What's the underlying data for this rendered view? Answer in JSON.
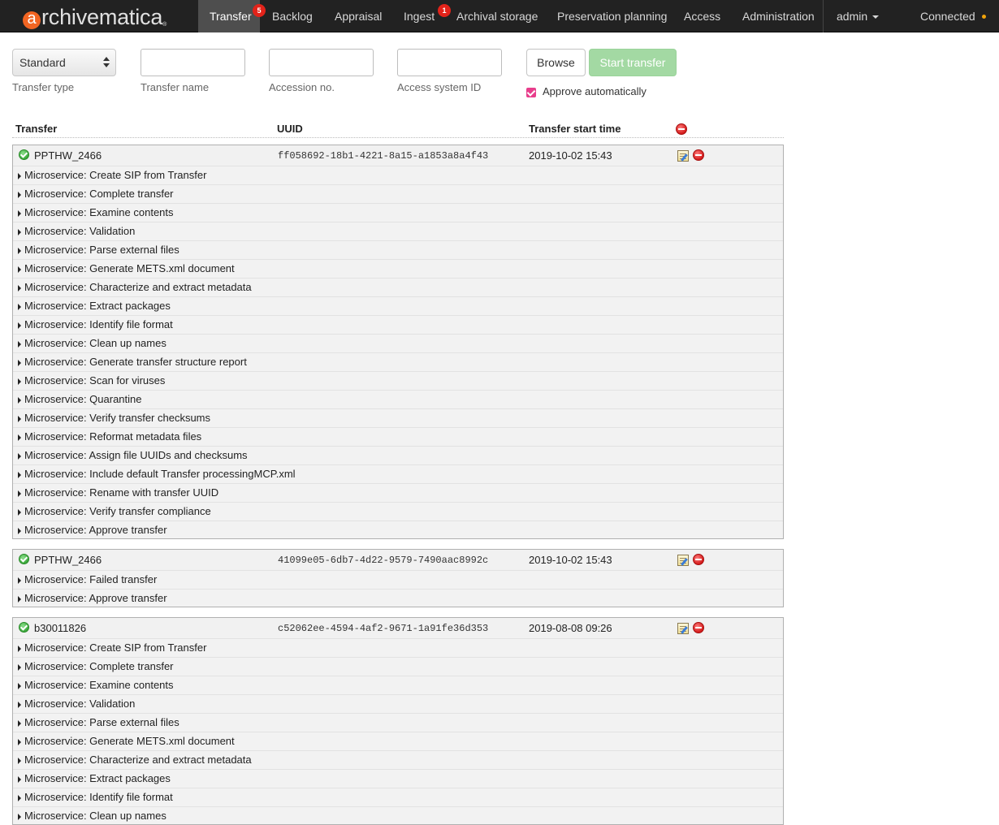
{
  "nav": {
    "brand": "archivematica",
    "items": [
      {
        "label": "Transfer",
        "badge": "5",
        "active": true
      },
      {
        "label": "Backlog"
      },
      {
        "label": "Appraisal"
      },
      {
        "label": "Ingest",
        "badge": "1"
      },
      {
        "label": "Archival storage"
      },
      {
        "label": "Preservation planning"
      },
      {
        "label": "Access"
      },
      {
        "label": "Administration"
      }
    ],
    "user": "admin",
    "status": "Connected"
  },
  "form": {
    "transfer_type": {
      "value": "Standard",
      "label": "Transfer type"
    },
    "transfer_name": {
      "label": "Transfer name",
      "value": ""
    },
    "accession_no": {
      "label": "Accession no.",
      "value": ""
    },
    "access_system_id": {
      "label": "Access system ID",
      "value": ""
    },
    "browse_label": "Browse",
    "start_label": "Start transfer",
    "approve_label": "Approve automatically",
    "approve_checked": true
  },
  "table": {
    "headers": {
      "transfer": "Transfer",
      "uuid": "UUID",
      "start_time": "Transfer start time"
    }
  },
  "transfers": [
    {
      "name": "PPTHW_2466",
      "uuid": "ff058692-18b1-4221-8a15-a1853a8a4f43",
      "start_time": "2019-10-02 15:43",
      "microservices": [
        "Microservice: Create SIP from Transfer",
        "Microservice: Complete transfer",
        "Microservice: Examine contents",
        "Microservice: Validation",
        "Microservice: Parse external files",
        "Microservice: Generate METS.xml document",
        "Microservice: Characterize and extract metadata",
        "Microservice: Extract packages",
        "Microservice: Identify file format",
        "Microservice: Clean up names",
        "Microservice: Generate transfer structure report",
        "Microservice: Scan for viruses",
        "Microservice: Quarantine",
        "Microservice: Verify transfer checksums",
        "Microservice: Reformat metadata files",
        "Microservice: Assign file UUIDs and checksums",
        "Microservice: Include default Transfer processingMCP.xml",
        "Microservice: Rename with transfer UUID",
        "Microservice: Verify transfer compliance",
        "Microservice: Approve transfer"
      ]
    },
    {
      "name": "PPTHW_2466",
      "uuid": "41099e05-6db7-4d22-9579-7490aac8992c",
      "start_time": "2019-10-02 15:43",
      "microservices": [
        "Microservice: Failed transfer",
        "Microservice: Approve transfer"
      ]
    },
    {
      "name": "b30011826",
      "uuid": "c52062ee-4594-4af2-9671-1a91fe36d353",
      "start_time": "2019-08-08 09:26",
      "microservices": [
        "Microservice: Create SIP from Transfer",
        "Microservice: Complete transfer",
        "Microservice: Examine contents",
        "Microservice: Validation",
        "Microservice: Parse external files",
        "Microservice: Generate METS.xml document",
        "Microservice: Characterize and extract metadata",
        "Microservice: Extract packages",
        "Microservice: Identify file format",
        "Microservice: Clean up names"
      ]
    }
  ]
}
